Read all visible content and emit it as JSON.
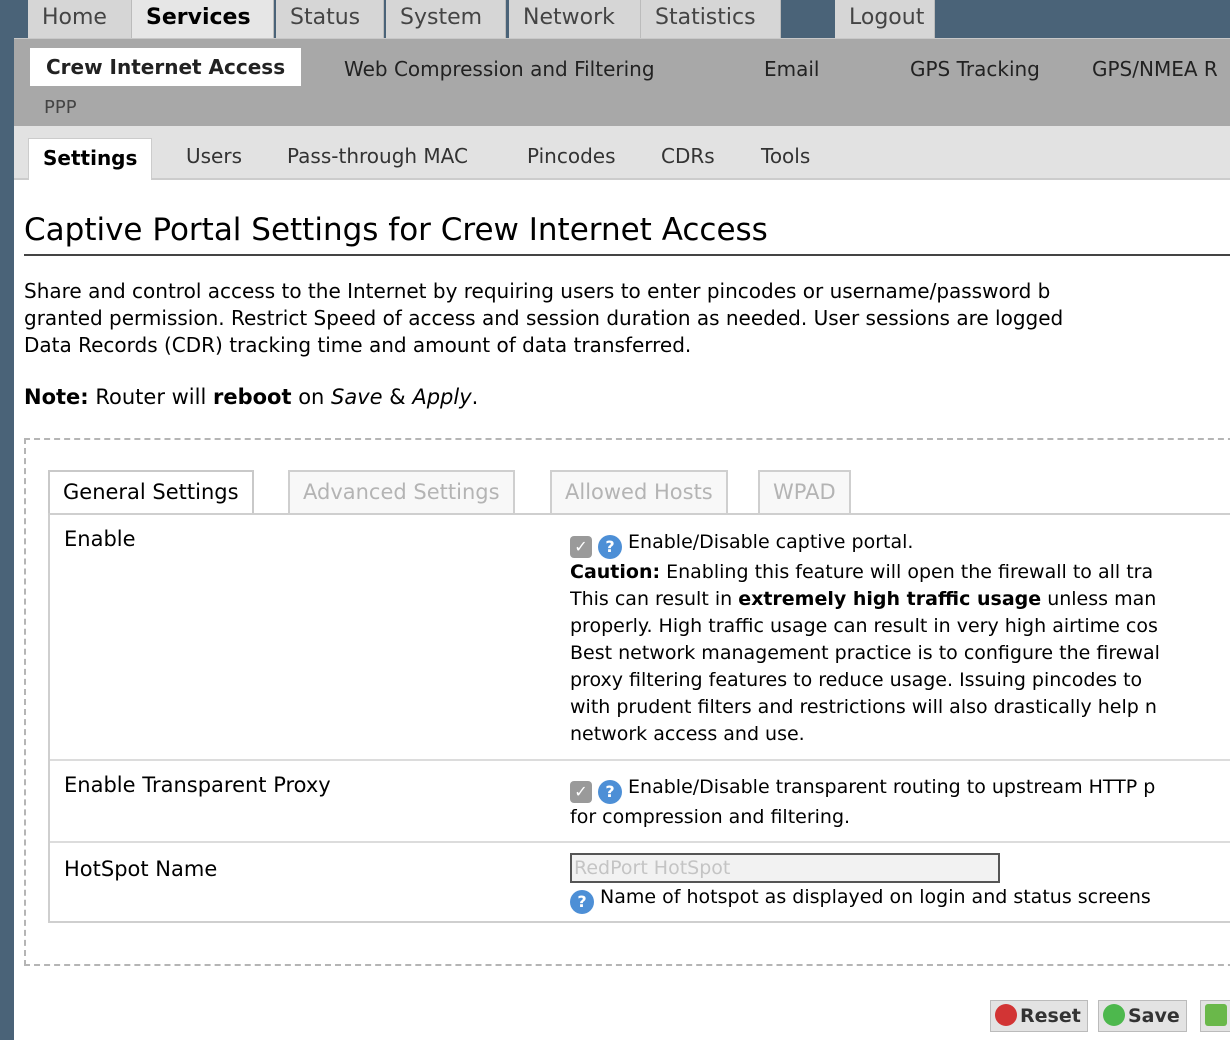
{
  "topnav": {
    "tabs": [
      "Home",
      "Services",
      "Status",
      "System",
      "Network",
      "Statistics",
      "Logout"
    ]
  },
  "subnav": {
    "items": [
      "Crew Internet Access",
      "Web Compression and Filtering",
      "Email",
      "GPS Tracking",
      "GPS/NMEA R",
      "PPP"
    ]
  },
  "thirdnav": {
    "items": [
      "Settings",
      "Users",
      "Pass-through MAC",
      "Pincodes",
      "CDRs",
      "Tools"
    ]
  },
  "main": {
    "title": "Captive Portal Settings for Crew Internet Access",
    "desc_lines": [
      "Share and control access to the Internet by requiring users to enter pincodes or username/password b",
      "granted permission. Restrict Speed of access and session duration as needed. User sessions are logged",
      "Data Records (CDR) tracking time and amount of data transferred."
    ],
    "note": {
      "label": "Note:",
      "t1": " Router will ",
      "reboot": "reboot",
      "t2": " on ",
      "save": "Save",
      "amp": " & ",
      "apply": "Apply",
      "end": "."
    },
    "panel_tabs": [
      "General Settings",
      "Advanced Settings",
      "Allowed Hosts",
      "WPAD"
    ],
    "rows": {
      "enable": {
        "label": "Enable",
        "desc": "Enable/Disable captive portal.",
        "caution_label": "Caution:",
        "caution_text": " Enabling this feature will open the firewall to all tra",
        "line2a": "This can result in ",
        "line2b": "extremely high traffic usage",
        "line2c": " unless man",
        "line3": "properly. High traffic usage can result in very high airtime cos",
        "line4": "Best network management practice is to configure the firewal",
        "line5": "proxy filtering features to reduce usage. Issuing pincodes to",
        "line6": "with prudent filters and restrictions will also drastically help n",
        "line7": "network access and use."
      },
      "proxy": {
        "label": "Enable Transparent Proxy",
        "desc1": "Enable/Disable transparent routing to upstream HTTP p",
        "desc2": "for compression and filtering."
      },
      "hotspot": {
        "label": "HotSpot Name",
        "value": "RedPort HotSpot",
        "help": "Name of hotspot as displayed on login and status screens"
      }
    },
    "buttons": {
      "reset": "Reset",
      "save": "Save"
    }
  }
}
